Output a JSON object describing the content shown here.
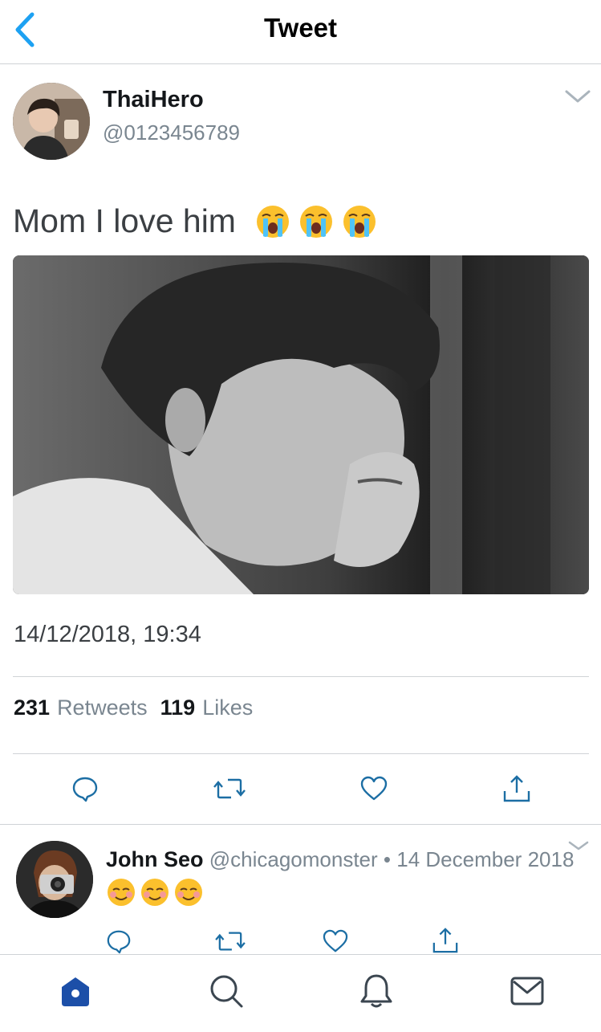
{
  "header": {
    "title": "Tweet",
    "back_icon": "chevron-left-icon"
  },
  "colors": {
    "accent": "#1da1f2",
    "tab_active": "#1c4fa8",
    "muted": "#7a8690",
    "divider": "#cfd3d6"
  },
  "tweet": {
    "author_name": "ThaiHero",
    "author_handle": "@0123456789",
    "text": "Mom I love him",
    "emojis": [
      "loudly-crying-face",
      "loudly-crying-face",
      "loudly-crying-face"
    ],
    "timestamp": "14/12/2018, 19:34",
    "retweets_count": "231",
    "retweets_label": "Retweets",
    "likes_count": "119",
    "likes_label": "Likes",
    "actions": [
      "reply-icon",
      "retweet-icon",
      "like-icon",
      "share-icon"
    ]
  },
  "reply": {
    "author_name": "John Seo",
    "author_handle": "@chicagomonster",
    "separator": "•",
    "date": "14 December 2018",
    "emojis": [
      "smiling-face",
      "smiling-face",
      "smiling-face"
    ],
    "actions": [
      "reply-icon",
      "retweet-icon",
      "like-icon",
      "share-icon"
    ]
  },
  "tabbar": {
    "items": [
      "home-icon",
      "search-icon",
      "notifications-icon",
      "messages-icon"
    ],
    "active": "home-icon"
  }
}
